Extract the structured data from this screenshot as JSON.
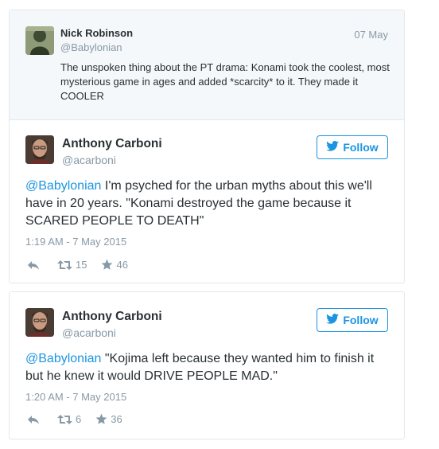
{
  "parent_tweet": {
    "name": "Nick Robinson",
    "handle": "@Babylonian",
    "date": "07 May",
    "text": "The unspoken thing about the PT drama: Konami took the coolest, most mysterious game in ages and added *scarcity* to it. They made it COOLER"
  },
  "tweets": [
    {
      "name": "Anthony Carboni",
      "handle": "@acarboni",
      "follow_label": "Follow",
      "mention": "@Babylonian",
      "text": " I'm psyched for the urban myths about this we'll have in 20 years. \"Konami destroyed the game because it SCARED PEOPLE TO DEATH\"",
      "timestamp": "1:19 AM - 7 May 2015",
      "retweets": "15",
      "favorites": "46"
    },
    {
      "name": "Anthony Carboni",
      "handle": "@acarboni",
      "follow_label": "Follow",
      "mention": "@Babylonian",
      "text": " \"Kojima left because they wanted him to finish it but he knew it would DRIVE PEOPLE MAD.\"",
      "timestamp": "1:20 AM - 7 May 2015",
      "retweets": "6",
      "favorites": "36"
    }
  ],
  "colors": {
    "link_blue": "#1b95e0",
    "muted_gray": "#8899a6",
    "parent_bg": "#f5f8fa"
  },
  "icons": [
    "reply-icon",
    "retweet-icon",
    "favorite-star-icon",
    "twitter-bird-icon"
  ]
}
